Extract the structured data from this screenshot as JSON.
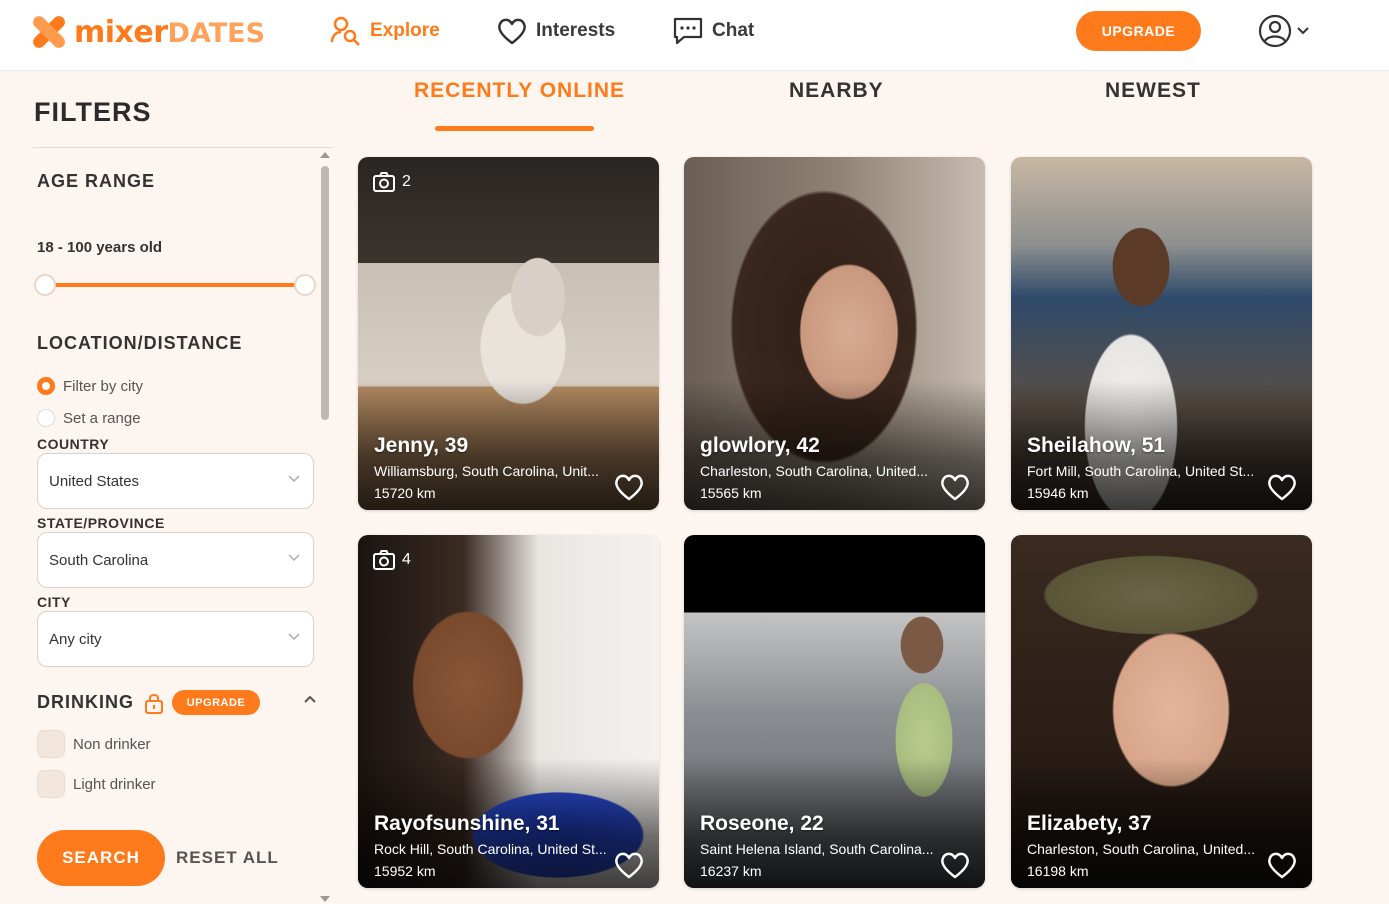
{
  "brand": {
    "name_part1": "mixer",
    "name_part2": "DATES"
  },
  "nav": {
    "explore": "Explore",
    "interests": "Interests",
    "chat": "Chat",
    "upgrade": "UPGRADE"
  },
  "filters": {
    "title": "FILTERS",
    "age": {
      "title": "AGE RANGE",
      "value": "18 - 100 years old",
      "min": 18,
      "max": 100
    },
    "location": {
      "title": "LOCATION/DISTANCE",
      "radio_city": "Filter by city",
      "radio_range": "Set a range",
      "country_label": "COUNTRY",
      "country_value": "United States",
      "state_label": "STATE/PROVINCE",
      "state_value": "South Carolina",
      "city_label": "CITY",
      "city_value": "Any city"
    },
    "drinking": {
      "title": "DRINKING",
      "upgrade": "UPGRADE",
      "options": [
        "Non drinker",
        "Light drinker"
      ]
    },
    "search": "SEARCH",
    "reset": "RESET ALL"
  },
  "tabs": [
    "RECENTLY ONLINE",
    "NEARBY",
    "NEWEST"
  ],
  "profiles": [
    {
      "name": "Jenny, 39",
      "location": "Williamsburg, South Carolina, Unit...",
      "distance": "15720 km",
      "photos": "2"
    },
    {
      "name": "glowlory, 42",
      "location": "Charleston, South Carolina, United...",
      "distance": "15565 km"
    },
    {
      "name": "Sheilahow, 51",
      "location": "Fort Mill, South Carolina, United St...",
      "distance": "15946 km"
    },
    {
      "name": "Rayofsunshine, 31",
      "location": "Rock Hill, South Carolina, United St...",
      "distance": "15952 km",
      "photos": "4"
    },
    {
      "name": "Roseone, 22",
      "location": "Saint Helena Island, South Carolina...",
      "distance": "16237 km"
    },
    {
      "name": "Elizabety, 37",
      "location": "Charleston, South Carolina, United...",
      "distance": "16198 km"
    }
  ],
  "colors": {
    "accent": "#ff7a1a",
    "background": "#fdf5ef"
  }
}
